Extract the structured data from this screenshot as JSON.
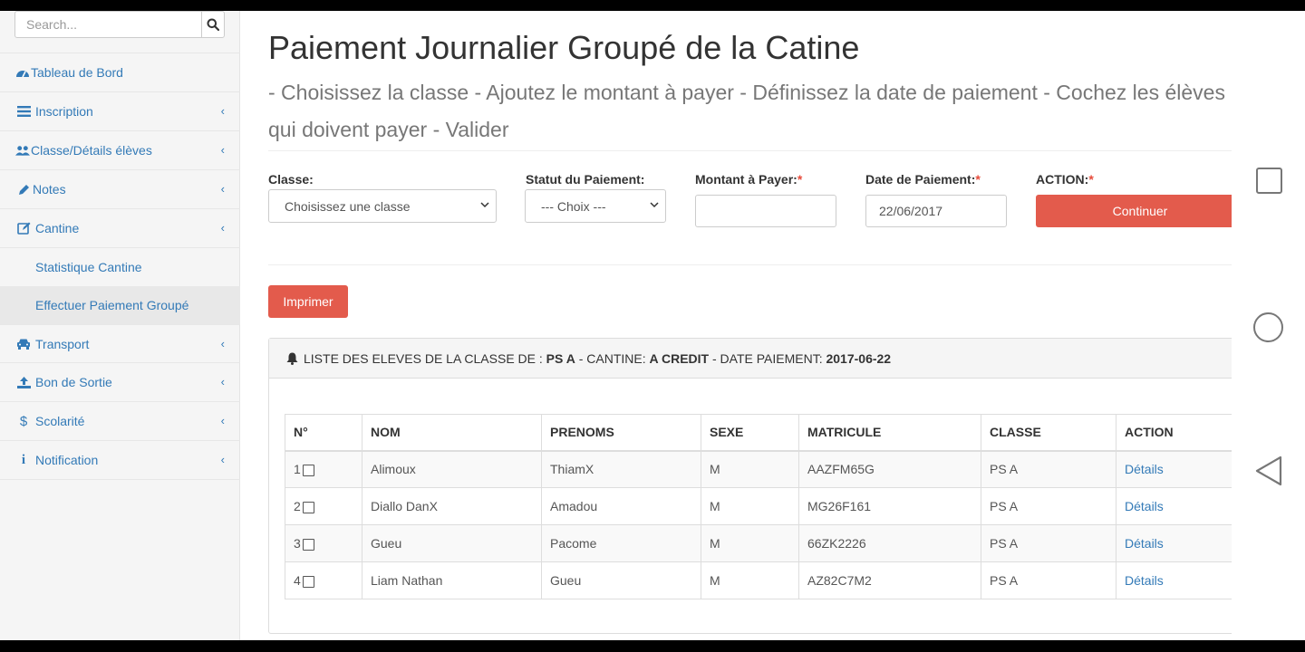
{
  "sidebar": {
    "search_placeholder": "Search...",
    "items": [
      {
        "label": "Tableau de Bord",
        "icon": "dashboard-icon"
      },
      {
        "label": "Inscription",
        "icon": "list-icon"
      },
      {
        "label": "Classe/Détails élèves",
        "icon": "users-icon"
      },
      {
        "label": "Notes",
        "icon": "pencil-icon"
      },
      {
        "label": "Cantine",
        "icon": "edit-icon"
      },
      {
        "label": "Transport",
        "icon": "car-icon"
      },
      {
        "label": "Bon de Sortie",
        "icon": "upload-icon"
      },
      {
        "label": "Scolarité",
        "icon": "dollar-icon"
      },
      {
        "label": "Notification",
        "icon": "info-icon"
      }
    ],
    "submenu": [
      {
        "label": "Statistique Cantine"
      },
      {
        "label": "Effectuer Paiement Groupé",
        "active": true
      }
    ]
  },
  "page": {
    "title": "Paiement Journalier Groupé de la Catine",
    "subtitle": "- Choisissez la classe - Ajoutez le montant à payer - Définissez la date de paiement - Cochez les élèves qui doivent payer - Valider"
  },
  "form": {
    "classe_label": "Classe:",
    "classe_value": "Choisissez une classe",
    "statut_label": "Statut du Paiement:",
    "statut_value": "--- Choix ---",
    "montant_label": "Montant à Payer:",
    "montant_value": "",
    "date_label": "Date de Paiement:",
    "date_value": "22/06/2017",
    "action_label": "ACTION:",
    "required_mark": "*",
    "continue_label": "Continuer"
  },
  "print_label": "Imprimer",
  "panel": {
    "prefix": "LISTE DES ELEVES DE LA CLASSE DE : ",
    "classe": "PS A",
    "cantine_prefix": " - CANTINE: ",
    "cantine": "A CREDIT",
    "date_prefix": " - DATE PAIEMENT: ",
    "date": "2017-06-22"
  },
  "table": {
    "headers": [
      "N°",
      "NOM",
      "PRENOMS",
      "SEXE",
      "MATRICULE",
      "CLASSE",
      "ACTION"
    ],
    "rows": [
      {
        "n": "1",
        "nom": "Alimoux",
        "prenoms": "ThiamX",
        "sexe": "M",
        "matricule": "AAZFM65G",
        "classe": "PS A",
        "action": "Détails"
      },
      {
        "n": "2",
        "nom": "Diallo DanX",
        "prenoms": "Amadou",
        "sexe": "M",
        "matricule": "MG26F161",
        "classe": "PS A",
        "action": "Détails"
      },
      {
        "n": "3",
        "nom": "Gueu",
        "prenoms": "Pacome",
        "sexe": "M",
        "matricule": "66ZK2226",
        "classe": "PS A",
        "action": "Détails"
      },
      {
        "n": "4",
        "nom": "Liam Nathan",
        "prenoms": "Gueu",
        "sexe": "M",
        "matricule": "AZ82C7M2",
        "classe": "PS A",
        "action": "Détails"
      }
    ]
  },
  "colors": {
    "accent": "#e35b4c",
    "link": "#337ab7"
  }
}
